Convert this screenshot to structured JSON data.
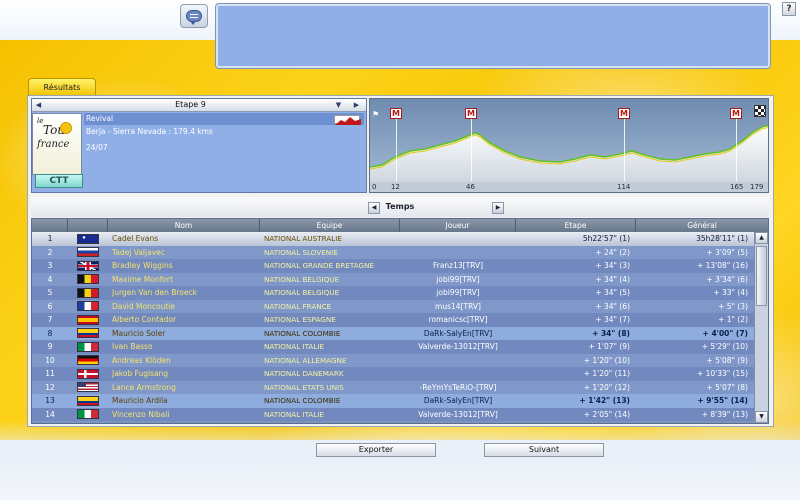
{
  "header": {
    "chat_icon": "chat-bubble-icon",
    "help_label": "?"
  },
  "tabs": {
    "results_label": "Résultats"
  },
  "stage": {
    "title": "Etape 9",
    "logo": {
      "le": "le",
      "tour": "Tour",
      "de": "de",
      "france": "france"
    },
    "badge": "CTT",
    "type": "Revival",
    "route": "Berja - Sierra Nevada : 179.4 kms",
    "date": "24/07"
  },
  "profile": {
    "markers": [
      {
        "km": 12,
        "label": "M"
      },
      {
        "km": 46,
        "label": "M"
      },
      {
        "km": 114,
        "label": "M"
      },
      {
        "km": 165,
        "label": "M"
      }
    ],
    "km_labels": [
      "0",
      "12",
      "46",
      "114",
      "165",
      "179"
    ],
    "total_km": 179.4
  },
  "temps": {
    "label": "Temps",
    "prev": "◀",
    "next": "▶"
  },
  "table": {
    "columns": [
      "",
      "",
      "Nom",
      "Equipe",
      "Joueur",
      "Etape",
      "Général"
    ],
    "rows": [
      {
        "rank": "1",
        "flag": "australia",
        "nom": "Cadel Evans",
        "team": "NATIONAL AUSTRALIE",
        "joueur": "",
        "etape": "5h22'57\" (1)",
        "gen": "35h28'11\" (1)",
        "style": "sel"
      },
      {
        "rank": "2",
        "flag": "slovenia",
        "nom": "Tadej Valjavec",
        "team": "NATIONAL SLOVENIE",
        "joueur": "",
        "etape": "+ 24\" (2)",
        "gen": "+ 3'09\" (5)",
        "style": "alt0"
      },
      {
        "rank": "3",
        "flag": "uk",
        "nom": "Bradley Wiggins",
        "team": "NATIONAL GRANDE BRETAGNE",
        "joueur": "Franz13[TRV]",
        "etape": "+ 34\" (3)",
        "gen": "+ 13'08\" (16)",
        "style": "alt1"
      },
      {
        "rank": "4",
        "flag": "belgium",
        "nom": "Maxime Monfort",
        "team": "NATIONAL BELGIQUE",
        "joueur": "jobi99[TRV]",
        "etape": "+ 34\" (4)",
        "gen": "+ 3'34\" (6)",
        "style": "alt0"
      },
      {
        "rank": "5",
        "flag": "belgium",
        "nom": "Jurgen Van den Broeck",
        "team": "NATIONAL BELGIQUE",
        "joueur": "jobi99[TRV]",
        "etape": "+ 34\" (5)",
        "gen": "+ 33\" (4)",
        "style": "alt1"
      },
      {
        "rank": "6",
        "flag": "france",
        "nom": "David Moncoutie",
        "team": "NATIONAL FRANCE",
        "joueur": "mus14[TRV]",
        "etape": "+ 34\" (6)",
        "gen": "+ 5\" (3)",
        "style": "alt0"
      },
      {
        "rank": "7",
        "flag": "spain",
        "nom": "Alberto Contador",
        "team": "NATIONAL ESPAGNE",
        "joueur": "romanicsc[TRV]",
        "etape": "+ 34\" (7)",
        "gen": "+ 1\" (2)",
        "style": "alt1"
      },
      {
        "rank": "8",
        "flag": "colombia",
        "nom": "Mauricio Soler",
        "team": "NATIONAL COLOMBIE",
        "joueur": "DaRk-SalyEn[TRV]",
        "etape": "+ 34\" (8)",
        "gen": "+ 4'00\" (7)",
        "style": "user"
      },
      {
        "rank": "9",
        "flag": "italy",
        "nom": "Ivan Basso",
        "team": "NATIONAL ITALIE",
        "joueur": "Valverde-13012[TRV]",
        "etape": "+ 1'07\" (9)",
        "gen": "+ 5'29\" (10)",
        "style": "alt1"
      },
      {
        "rank": "10",
        "flag": "germany",
        "nom": "Andreas Klöden",
        "team": "NATIONAL ALLEMAGNE",
        "joueur": "",
        "etape": "+ 1'20\" (10)",
        "gen": "+ 5'08\" (9)",
        "style": "alt0"
      },
      {
        "rank": "11",
        "flag": "denmark",
        "nom": "Jakob Fuglsang",
        "team": "NATIONAL DANEMARK",
        "joueur": "",
        "etape": "+ 1'20\" (11)",
        "gen": "+ 10'33\" (15)",
        "style": "alt1"
      },
      {
        "rank": "12",
        "flag": "usa",
        "nom": "Lance Armstrong",
        "team": "NATIONAL ETATS UNIS",
        "joueur": "-ReYmYsTeRiO-[TRV]",
        "etape": "+ 1'20\" (12)",
        "gen": "+ 5'07\" (8)",
        "style": "alt0"
      },
      {
        "rank": "13",
        "flag": "colombia",
        "nom": "Mauricio Ardila",
        "team": "NATIONAL COLOMBIE",
        "joueur": "DaRk-SalyEn[TRV]",
        "etape": "+ 1'42\" (13)",
        "gen": "+ 9'55\" (14)",
        "style": "user"
      },
      {
        "rank": "14",
        "flag": "italy",
        "nom": "Vincenzo Nibali",
        "team": "NATIONAL ITALIE",
        "joueur": "Valverde-13012[TRV]",
        "etape": "+ 2'05\" (14)",
        "gen": "+ 8'39\" (13)",
        "style": "alt1"
      }
    ]
  },
  "actions": {
    "export_label": "Exporter",
    "next_label": "Suivant"
  }
}
